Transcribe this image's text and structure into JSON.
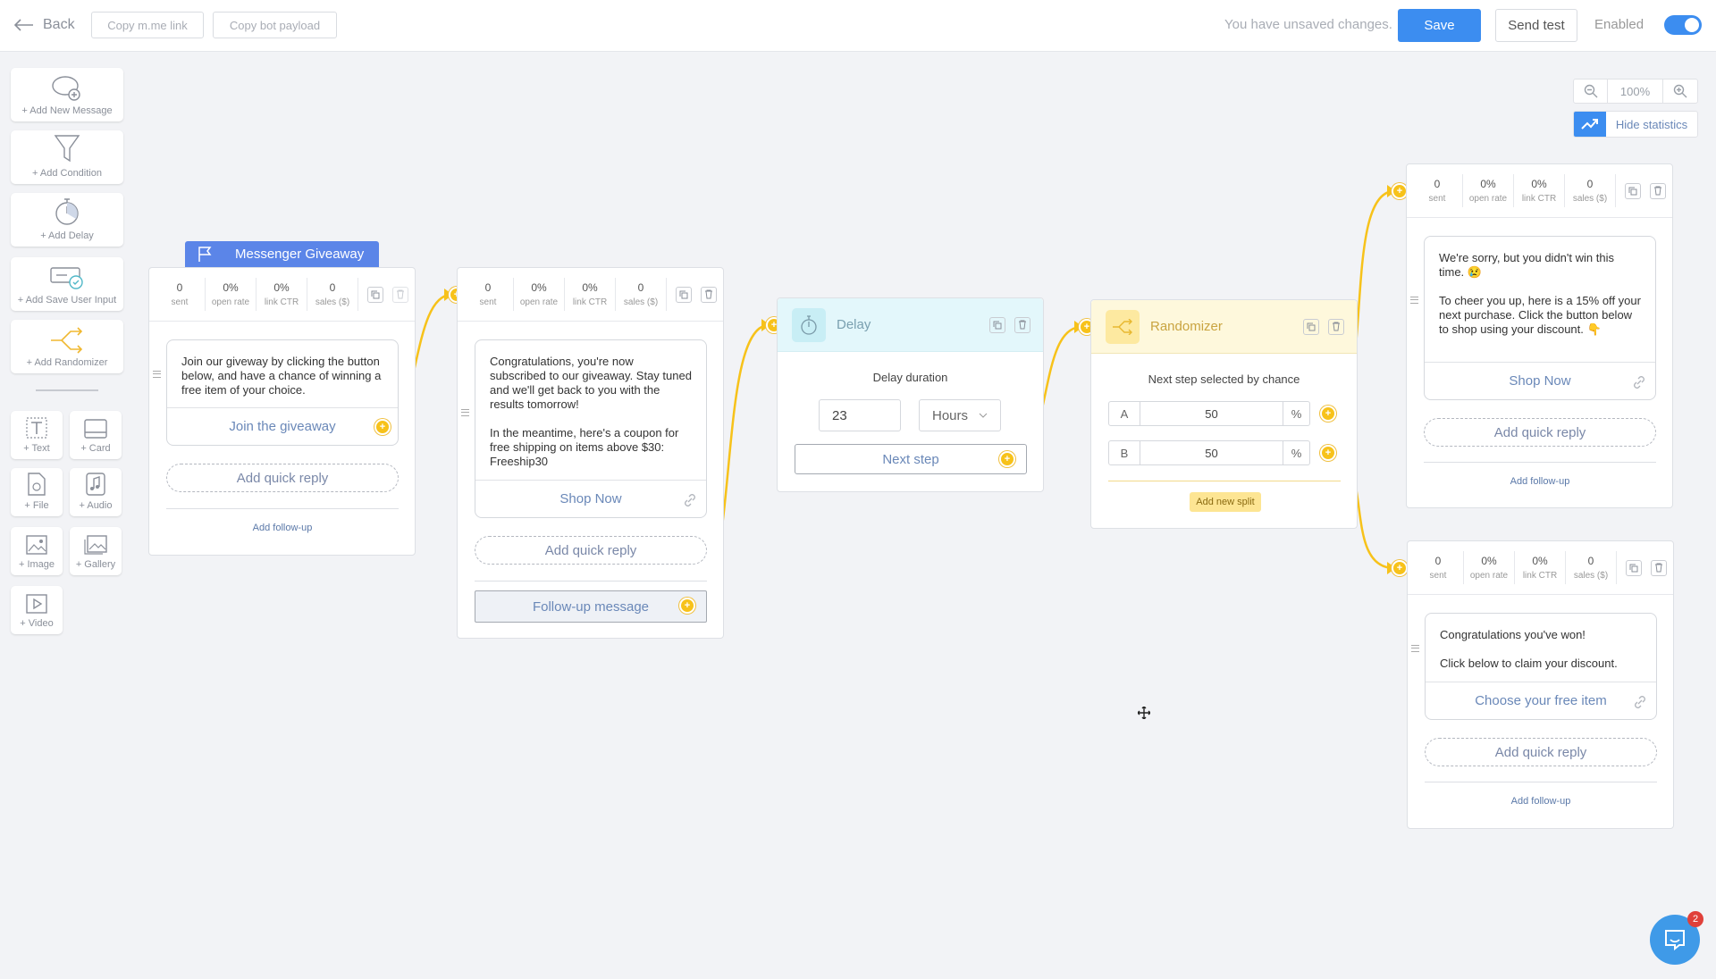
{
  "topbar": {
    "back": "Back",
    "copy_link": "Copy m.me link",
    "copy_payload": "Copy bot payload",
    "unsaved": "You have unsaved changes.",
    "save": "Save",
    "send_test": "Send test",
    "enabled": "Enabled"
  },
  "palette": {
    "add_message": "+ Add New Message",
    "add_condition": "+ Add Condition",
    "add_delay": "+ Add Delay",
    "add_save_input": "+ Add Save User Input",
    "add_randomizer": "+ Add Randomizer",
    "text": "+ Text",
    "card": "+ Card",
    "file": "+ File",
    "audio": "+ Audio",
    "image": "+ Image",
    "gallery": "+ Gallery",
    "video": "+ Video"
  },
  "zoom": {
    "level": "100%",
    "hide_stats": "Hide statistics"
  },
  "stat_labels": {
    "sent": "sent",
    "open_rate": "open rate",
    "link_ctr": "link CTR",
    "sales": "sales ($)"
  },
  "stat_values": {
    "sent": "0",
    "open_rate": "0%",
    "link_ctr": "0%",
    "sales": "0"
  },
  "node1": {
    "flag": "Messenger Giveaway",
    "text": "Join our giveway by clicking the button below, and have a chance of winning a free item of your choice.",
    "button": "Join the giveaway",
    "quick_reply": "Add quick reply",
    "follow_up": "Add follow-up"
  },
  "node2": {
    "text": "Congratulations, you're now subscribed to our giveaway. Stay tuned and we'll get back to you with the results tomorrow!\n\nIn the meantime, here's a coupon for free shipping on items above $30: Freeship30",
    "button": "Shop Now",
    "quick_reply": "Add quick reply",
    "follow_up": "Follow-up message"
  },
  "delay": {
    "title": "Delay",
    "duration_label": "Delay duration",
    "value": "23",
    "unit": "Hours",
    "next_step": "Next step"
  },
  "randomizer": {
    "title": "Randomizer",
    "label": "Next step selected by chance",
    "splits": [
      {
        "letter": "A",
        "value": "50",
        "pct": "%"
      },
      {
        "letter": "B",
        "value": "50",
        "pct": "%"
      }
    ],
    "add_split": "Add new split"
  },
  "node3": {
    "text": "We're sorry, but you didn't win this time. 😢\n\nTo cheer you up, here is a 15% off your next purchase. Click the button below to shop using your discount. 👇",
    "button": "Shop Now",
    "quick_reply": "Add quick reply",
    "follow_up": "Add follow-up"
  },
  "node4": {
    "text": "Congratulations you've won!\n\nClick below to claim your discount.",
    "button": "Choose your free item",
    "quick_reply": "Add quick reply",
    "follow_up": "Add follow-up"
  },
  "chat": {
    "badge": "2"
  },
  "colors": {
    "accent": "#3c8df0",
    "connector": "#f7c21a",
    "delay_bg": "#e3f7fb",
    "randomizer_bg": "#fef8dc"
  }
}
